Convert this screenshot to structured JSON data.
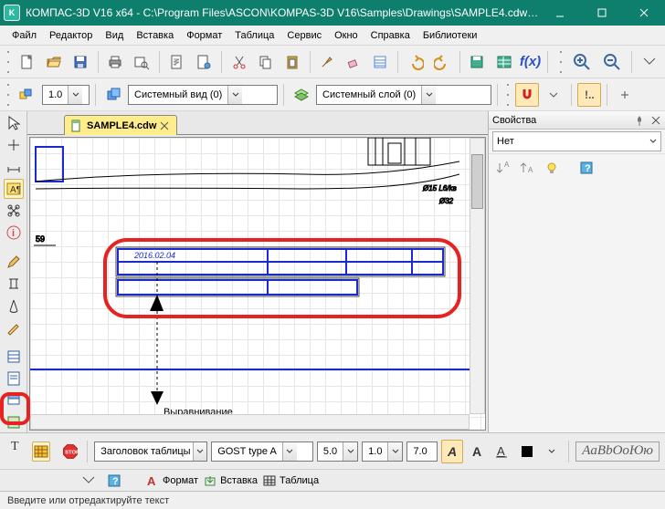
{
  "titlebar": {
    "app": "КОМПАС-3D V16  x64",
    "path": "C:\\Program Files\\ASCON\\KOMPAS-3D V16\\Samples\\Drawings\\SAMPLE4.cdw (то..."
  },
  "menu": {
    "file": "Файл",
    "editor": "Редактор",
    "view": "Вид",
    "insert": "Вставка",
    "format": "Формат",
    "table": "Таблица",
    "service": "Сервис",
    "window": "Окно",
    "help": "Справка",
    "libs": "Библиотеки"
  },
  "toolbar2": {
    "scale": "1.0",
    "view_name": "Системный вид (0)",
    "layer_name": "Системный слой (0)"
  },
  "fx_label": "f(x)",
  "tab": {
    "name": "SAMPLE4.cdw"
  },
  "props": {
    "title": "Свойства",
    "value": "Нет"
  },
  "canvas": {
    "date": "2016.02.04",
    "dim59": "59",
    "label_align": "Выравнивание",
    "phi_note": "Ø15 L6/kв",
    "phi_note2": "Ø32"
  },
  "bottom": {
    "stop": "STOP",
    "style": "Заголовок таблицы",
    "font": "GOST type A",
    "size1": "5.0",
    "size2": "1.0",
    "size3": "7.0",
    "tab_format": "Формат",
    "tab_insert": "Вставка",
    "tab_table": "Таблица",
    "fontpreview": "AaBbОоЮю"
  },
  "status": {
    "hint": "Введите или отредактируйте текст"
  }
}
